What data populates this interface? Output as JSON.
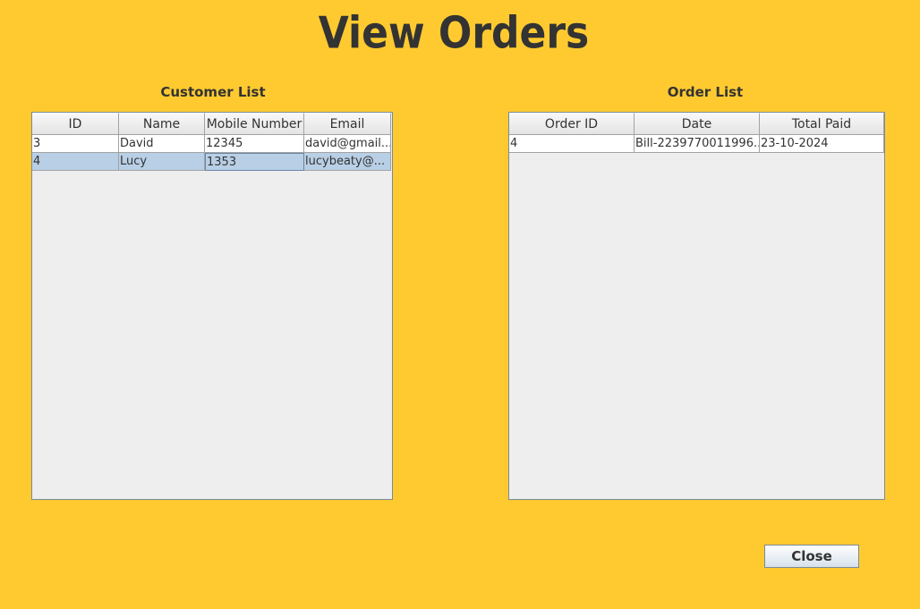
{
  "window": {
    "title": "View Orders"
  },
  "customer_list": {
    "label": "Customer List",
    "columns": [
      "ID",
      "Name",
      "Mobile Number",
      "Email"
    ],
    "rows": [
      [
        "3",
        "David",
        "12345",
        "david@gmail..."
      ],
      [
        "4",
        "Lucy",
        "1353",
        "lucybeaty@..."
      ]
    ]
  },
  "order_list": {
    "label": "Order List",
    "columns": [
      "Order ID",
      "Date",
      "Total Paid"
    ],
    "rows": [
      [
        "4",
        "Bill-2239770011996...",
        "23-10-2024"
      ]
    ]
  },
  "buttons": {
    "close_label": "Close"
  },
  "colors": {
    "background": "#FFCA30",
    "text": "#333333",
    "selection": "#B8CFE5",
    "table_empty": "#EEEEEE"
  }
}
